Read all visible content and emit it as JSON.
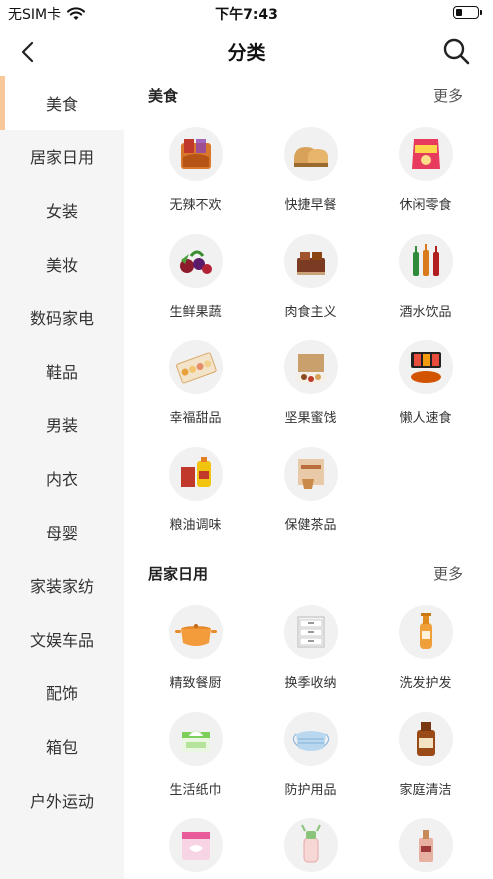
{
  "status_bar": {
    "carrier": "无SIM卡",
    "time": "下午7:43",
    "battery_level": 0.3
  },
  "nav": {
    "title": "分类"
  },
  "sidebar": {
    "items": [
      {
        "label": "美食",
        "active": true
      },
      {
        "label": "居家日用"
      },
      {
        "label": "女装"
      },
      {
        "label": "美妆"
      },
      {
        "label": "数码家电"
      },
      {
        "label": "鞋品"
      },
      {
        "label": "男装"
      },
      {
        "label": "内衣"
      },
      {
        "label": "母婴"
      },
      {
        "label": "家装家纺"
      },
      {
        "label": "文娱车品"
      },
      {
        "label": "配饰"
      },
      {
        "label": "箱包"
      },
      {
        "label": "户外运动"
      }
    ]
  },
  "sections": [
    {
      "title": "美食",
      "more": "更多",
      "items": [
        {
          "label": "无辣不欢",
          "icon": "spicy-snack-icon"
        },
        {
          "label": "快捷早餐",
          "icon": "bread-icon"
        },
        {
          "label": "休闲零食",
          "icon": "chips-bag-icon"
        },
        {
          "label": "生鲜果蔬",
          "icon": "fruit-icon"
        },
        {
          "label": "肉食主义",
          "icon": "meat-icon"
        },
        {
          "label": "酒水饮品",
          "icon": "drinks-icon"
        },
        {
          "label": "幸福甜品",
          "icon": "dessert-box-icon"
        },
        {
          "label": "坚果蜜饯",
          "icon": "nuts-gift-box-icon"
        },
        {
          "label": "懒人速食",
          "icon": "instant-noodles-icon"
        },
        {
          "label": "粮油调味",
          "icon": "cooking-oil-icon"
        },
        {
          "label": "保健茶品",
          "icon": "tea-box-icon"
        }
      ]
    },
    {
      "title": "居家日用",
      "more": "更多",
      "items": [
        {
          "label": "精致餐厨",
          "icon": "cooking-pot-icon"
        },
        {
          "label": "换季收纳",
          "icon": "storage-drawers-icon"
        },
        {
          "label": "洗发护发",
          "icon": "shampoo-bottle-icon"
        },
        {
          "label": "生活纸巾",
          "icon": "tissue-pack-icon"
        },
        {
          "label": "防护用品",
          "icon": "face-mask-icon"
        },
        {
          "label": "家庭清洁",
          "icon": "disinfectant-bottle-icon"
        },
        {
          "label": "",
          "icon": "sanitary-pad-icon"
        },
        {
          "label": "",
          "icon": "water-bottle-icon"
        },
        {
          "label": "",
          "icon": "perfume-bottle-icon"
        }
      ]
    }
  ]
}
